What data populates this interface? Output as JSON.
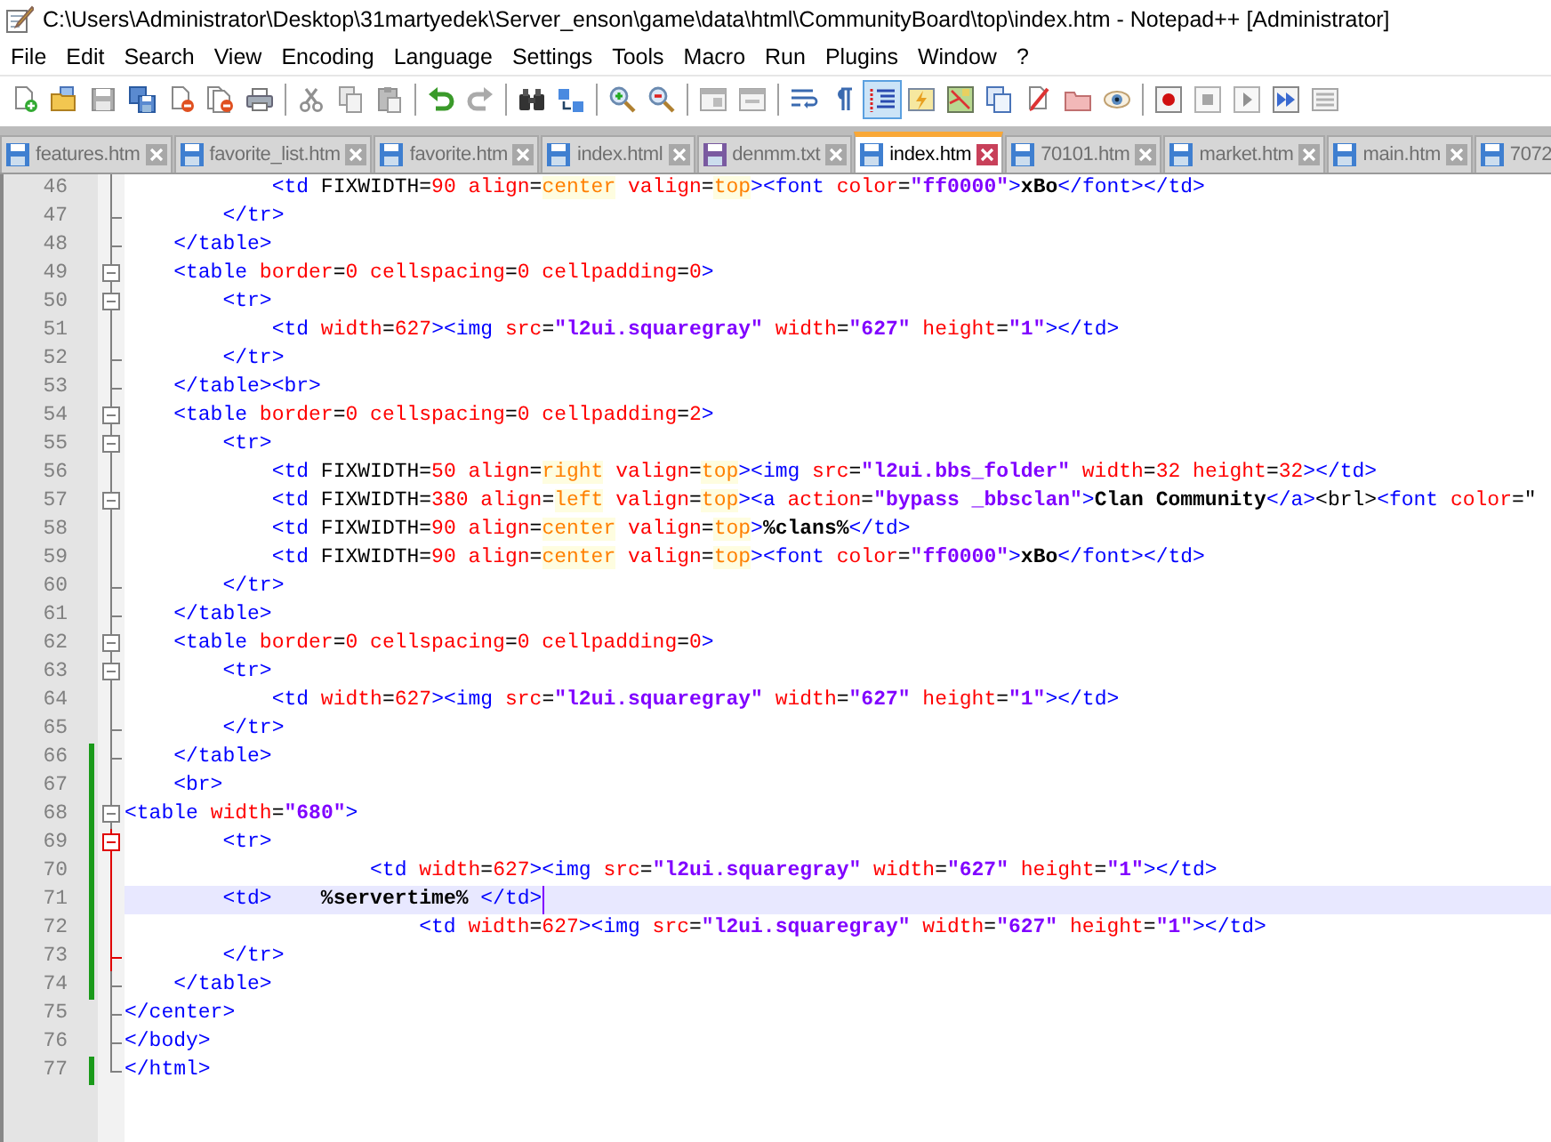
{
  "window": {
    "title": "C:\\Users\\Administrator\\Desktop\\31martyedek\\Server_enson\\game\\data\\html\\CommunityBoard\\top\\index.htm - Notepad++ [Administrator]"
  },
  "menu": [
    "File",
    "Edit",
    "Search",
    "View",
    "Encoding",
    "Language",
    "Settings",
    "Tools",
    "Macro",
    "Run",
    "Plugins",
    "Window",
    "?"
  ],
  "toolbar": {
    "groups": [
      {
        "buttons": [
          {
            "kind": "new",
            "disabled": false,
            "selected": false
          },
          {
            "kind": "open",
            "disabled": false,
            "selected": false
          },
          {
            "kind": "save",
            "disabled": true,
            "selected": false
          },
          {
            "kind": "save_all",
            "disabled": false,
            "selected": false
          },
          {
            "kind": "close",
            "disabled": false,
            "selected": false
          },
          {
            "kind": "close_all",
            "disabled": false,
            "selected": false
          },
          {
            "kind": "print",
            "disabled": false,
            "selected": false
          }
        ]
      },
      {
        "buttons": [
          {
            "kind": "cut",
            "disabled": true,
            "selected": false
          },
          {
            "kind": "copy",
            "disabled": true,
            "selected": false
          },
          {
            "kind": "paste",
            "disabled": true,
            "selected": false
          }
        ]
      },
      {
        "buttons": [
          {
            "kind": "undo",
            "disabled": false,
            "selected": false
          },
          {
            "kind": "redo",
            "disabled": true,
            "selected": false
          }
        ]
      },
      {
        "buttons": [
          {
            "kind": "find",
            "disabled": false,
            "selected": false
          },
          {
            "kind": "replace",
            "disabled": false,
            "selected": false
          }
        ]
      },
      {
        "buttons": [
          {
            "kind": "zoom_in",
            "disabled": false,
            "selected": false
          },
          {
            "kind": "zoom_out",
            "disabled": false,
            "selected": false
          }
        ]
      },
      {
        "buttons": [
          {
            "kind": "sync_v",
            "disabled": true,
            "selected": false
          },
          {
            "kind": "sync_h",
            "disabled": true,
            "selected": false
          }
        ]
      },
      {
        "buttons": [
          {
            "kind": "wrap",
            "disabled": false,
            "selected": false
          },
          {
            "kind": "all_chars",
            "disabled": false,
            "selected": false
          },
          {
            "kind": "indent_guide",
            "disabled": false,
            "selected": true
          },
          {
            "kind": "udl",
            "disabled": false,
            "selected": false
          },
          {
            "kind": "doc_map",
            "disabled": false,
            "selected": false
          },
          {
            "kind": "func_list",
            "disabled": false,
            "selected": false
          },
          {
            "kind": "pen_page",
            "disabled": false,
            "selected": false
          },
          {
            "kind": "folder",
            "disabled": false,
            "selected": false
          },
          {
            "kind": "monitor",
            "disabled": false,
            "selected": false
          }
        ]
      },
      {
        "buttons": [
          {
            "kind": "record",
            "disabled": false,
            "selected": false
          },
          {
            "kind": "stop",
            "disabled": true,
            "selected": false
          },
          {
            "kind": "play",
            "disabled": true,
            "selected": false
          },
          {
            "kind": "play_multi",
            "disabled": false,
            "selected": false
          },
          {
            "kind": "save_macro",
            "disabled": true,
            "selected": false
          }
        ]
      }
    ]
  },
  "tabs": [
    {
      "label": "features.htm",
      "selected": false,
      "color": "#3f7fd0"
    },
    {
      "label": "favorite_list.htm",
      "selected": false,
      "color": "#3f7fd0"
    },
    {
      "label": "favorite.htm",
      "selected": false,
      "color": "#3f7fd0"
    },
    {
      "label": "index.html",
      "selected": false,
      "color": "#3f7fd0"
    },
    {
      "label": "denmm.txt",
      "selected": false,
      "color": "#7a5aa0"
    },
    {
      "label": "index.htm",
      "selected": true,
      "color": "#3f7fd0"
    },
    {
      "label": "70101.htm",
      "selected": false,
      "color": "#3f7fd0"
    },
    {
      "label": "market.htm",
      "selected": false,
      "color": "#3f7fd0"
    },
    {
      "label": "main.htm",
      "selected": false,
      "color": "#3f7fd0"
    },
    {
      "label": "7072",
      "selected": false,
      "color": "#3f7fd0"
    }
  ],
  "editor": {
    "lines": [
      {
        "number": "46",
        "kind": "fold_body",
        "highlighted": false,
        "changed": false,
        "selected": false,
        "tokens": [
          {
            "kind": "tag",
            "text": "            <td"
          },
          {
            "kind": "plain",
            "text": " FIXWIDTH="
          },
          {
            "kind": "attr",
            "text": "90"
          },
          {
            "kind": "attr",
            "text": " align"
          },
          {
            "kind": "plain",
            "text": "="
          },
          {
            "kind": "word",
            "text": "center"
          },
          {
            "kind": "attr",
            "text": " valign"
          },
          {
            "kind": "plain",
            "text": "="
          },
          {
            "kind": "word",
            "text": "top"
          },
          {
            "kind": "tag",
            "text": "><font"
          },
          {
            "kind": "attr",
            "text": " color"
          },
          {
            "kind": "plain",
            "text": "="
          },
          {
            "kind": "str",
            "text": "\"ff0000\""
          },
          {
            "kind": "tag",
            "text": ">"
          },
          {
            "kind": "text",
            "text": "xBo"
          },
          {
            "kind": "tag",
            "text": "</font></td>"
          }
        ]
      },
      {
        "number": "47",
        "kind": "fold_end",
        "highlighted": false,
        "changed": false,
        "selected": false,
        "tokens": [
          {
            "kind": "tag",
            "text": "        </tr>"
          }
        ]
      },
      {
        "number": "48",
        "kind": "fold_end",
        "highlighted": false,
        "changed": false,
        "selected": false,
        "tokens": [
          {
            "kind": "tag",
            "text": "    </table>"
          }
        ]
      },
      {
        "number": "49",
        "kind": "fold_start",
        "highlighted": false,
        "changed": false,
        "selected": false,
        "tokens": [
          {
            "kind": "tag",
            "text": "    <table"
          },
          {
            "kind": "attr",
            "text": " border"
          },
          {
            "kind": "plain",
            "text": "="
          },
          {
            "kind": "attr",
            "text": "0"
          },
          {
            "kind": "attr",
            "text": " cellspacing"
          },
          {
            "kind": "plain",
            "text": "="
          },
          {
            "kind": "attr",
            "text": "0"
          },
          {
            "kind": "attr",
            "text": " cellpadding"
          },
          {
            "kind": "plain",
            "text": "="
          },
          {
            "kind": "attr",
            "text": "0"
          },
          {
            "kind": "tag",
            "text": ">"
          }
        ]
      },
      {
        "number": "50",
        "kind": "fold_start",
        "highlighted": false,
        "changed": false,
        "selected": false,
        "tokens": [
          {
            "kind": "tag",
            "text": "        <tr>"
          }
        ]
      },
      {
        "number": "51",
        "kind": "fold_body",
        "highlighted": false,
        "changed": false,
        "selected": false,
        "tokens": [
          {
            "kind": "tag",
            "text": "            <td"
          },
          {
            "kind": "attr",
            "text": " width"
          },
          {
            "kind": "plain",
            "text": "="
          },
          {
            "kind": "attr",
            "text": "627"
          },
          {
            "kind": "tag",
            "text": "><img"
          },
          {
            "kind": "attr",
            "text": " src"
          },
          {
            "kind": "plain",
            "text": "="
          },
          {
            "kind": "str",
            "text": "\"l2ui.squaregray\""
          },
          {
            "kind": "attr",
            "text": " width"
          },
          {
            "kind": "plain",
            "text": "="
          },
          {
            "kind": "str",
            "text": "\"627\""
          },
          {
            "kind": "attr",
            "text": " height"
          },
          {
            "kind": "plain",
            "text": "="
          },
          {
            "kind": "str",
            "text": "\"1\""
          },
          {
            "kind": "tag",
            "text": "></td>"
          }
        ]
      },
      {
        "number": "52",
        "kind": "fold_end",
        "highlighted": false,
        "changed": false,
        "selected": false,
        "tokens": [
          {
            "kind": "tag",
            "text": "        </tr>"
          }
        ]
      },
      {
        "number": "53",
        "kind": "fold_end",
        "highlighted": false,
        "changed": false,
        "selected": false,
        "tokens": [
          {
            "kind": "tag",
            "text": "    </table><br>"
          }
        ]
      },
      {
        "number": "54",
        "kind": "fold_start",
        "highlighted": false,
        "changed": false,
        "selected": false,
        "tokens": [
          {
            "kind": "tag",
            "text": "    <table"
          },
          {
            "kind": "attr",
            "text": " border"
          },
          {
            "kind": "plain",
            "text": "="
          },
          {
            "kind": "attr",
            "text": "0"
          },
          {
            "kind": "attr",
            "text": " cellspacing"
          },
          {
            "kind": "plain",
            "text": "="
          },
          {
            "kind": "attr",
            "text": "0"
          },
          {
            "kind": "attr",
            "text": " cellpadding"
          },
          {
            "kind": "plain",
            "text": "="
          },
          {
            "kind": "attr",
            "text": "2"
          },
          {
            "kind": "tag",
            "text": ">"
          }
        ]
      },
      {
        "number": "55",
        "kind": "fold_start",
        "highlighted": false,
        "changed": false,
        "selected": false,
        "tokens": [
          {
            "kind": "tag",
            "text": "        <tr>"
          }
        ]
      },
      {
        "number": "56",
        "kind": "fold_body",
        "highlighted": false,
        "changed": false,
        "selected": false,
        "tokens": [
          {
            "kind": "tag",
            "text": "            <td"
          },
          {
            "kind": "plain",
            "text": " FIXWIDTH="
          },
          {
            "kind": "attr",
            "text": "50"
          },
          {
            "kind": "attr",
            "text": " align"
          },
          {
            "kind": "plain",
            "text": "="
          },
          {
            "kind": "word",
            "text": "right"
          },
          {
            "kind": "attr",
            "text": " valign"
          },
          {
            "kind": "plain",
            "text": "="
          },
          {
            "kind": "word",
            "text": "top"
          },
          {
            "kind": "tag",
            "text": "><img"
          },
          {
            "kind": "attr",
            "text": " src"
          },
          {
            "kind": "plain",
            "text": "="
          },
          {
            "kind": "str",
            "text": "\"l2ui.bbs_folder\""
          },
          {
            "kind": "attr",
            "text": " width"
          },
          {
            "kind": "plain",
            "text": "="
          },
          {
            "kind": "attr",
            "text": "32"
          },
          {
            "kind": "attr",
            "text": " height"
          },
          {
            "kind": "plain",
            "text": "="
          },
          {
            "kind": "attr",
            "text": "32"
          },
          {
            "kind": "tag",
            "text": "></td>"
          }
        ]
      },
      {
        "number": "57",
        "kind": "fold_start",
        "highlighted": false,
        "changed": false,
        "selected": false,
        "tokens": [
          {
            "kind": "tag",
            "text": "            <td"
          },
          {
            "kind": "plain",
            "text": " FIXWIDTH="
          },
          {
            "kind": "attr",
            "text": "380"
          },
          {
            "kind": "attr",
            "text": " align"
          },
          {
            "kind": "plain",
            "text": "="
          },
          {
            "kind": "word",
            "text": "left"
          },
          {
            "kind": "attr",
            "text": " valign"
          },
          {
            "kind": "plain",
            "text": "="
          },
          {
            "kind": "word",
            "text": "top"
          },
          {
            "kind": "tag",
            "text": "><a"
          },
          {
            "kind": "attr",
            "text": " action"
          },
          {
            "kind": "plain",
            "text": "="
          },
          {
            "kind": "str",
            "text": "\"bypass _bbsclan\""
          },
          {
            "kind": "tag",
            "text": ">"
          },
          {
            "kind": "text",
            "text": "Clan Community"
          },
          {
            "kind": "tag",
            "text": "</a>"
          },
          {
            "kind": "plain",
            "text": "<brl>"
          },
          {
            "kind": "tag",
            "text": "<font"
          },
          {
            "kind": "attr",
            "text": " color"
          },
          {
            "kind": "plain",
            "text": "=\""
          }
        ]
      },
      {
        "number": "58",
        "kind": "fold_body",
        "highlighted": false,
        "changed": false,
        "selected": false,
        "tokens": [
          {
            "kind": "tag",
            "text": "            <td"
          },
          {
            "kind": "plain",
            "text": " FIXWIDTH="
          },
          {
            "kind": "attr",
            "text": "90"
          },
          {
            "kind": "attr",
            "text": " align"
          },
          {
            "kind": "plain",
            "text": "="
          },
          {
            "kind": "word",
            "text": "center"
          },
          {
            "kind": "attr",
            "text": " valign"
          },
          {
            "kind": "plain",
            "text": "="
          },
          {
            "kind": "word",
            "text": "top"
          },
          {
            "kind": "tag",
            "text": ">"
          },
          {
            "kind": "text",
            "text": "%clans%"
          },
          {
            "kind": "tag",
            "text": "</td>"
          }
        ]
      },
      {
        "number": "59",
        "kind": "fold_body",
        "highlighted": false,
        "changed": false,
        "selected": false,
        "tokens": [
          {
            "kind": "tag",
            "text": "            <td"
          },
          {
            "kind": "plain",
            "text": " FIXWIDTH="
          },
          {
            "kind": "attr",
            "text": "90"
          },
          {
            "kind": "attr",
            "text": " align"
          },
          {
            "kind": "plain",
            "text": "="
          },
          {
            "kind": "word",
            "text": "center"
          },
          {
            "kind": "attr",
            "text": " valign"
          },
          {
            "kind": "plain",
            "text": "="
          },
          {
            "kind": "word",
            "text": "top"
          },
          {
            "kind": "tag",
            "text": "><font"
          },
          {
            "kind": "attr",
            "text": " color"
          },
          {
            "kind": "plain",
            "text": "="
          },
          {
            "kind": "str",
            "text": "\"ff0000\""
          },
          {
            "kind": "tag",
            "text": ">"
          },
          {
            "kind": "text",
            "text": "xBo"
          },
          {
            "kind": "tag",
            "text": "</font></td>"
          }
        ]
      },
      {
        "number": "60",
        "kind": "fold_end",
        "highlighted": false,
        "changed": false,
        "selected": false,
        "tokens": [
          {
            "kind": "tag",
            "text": "        </tr>"
          }
        ]
      },
      {
        "number": "61",
        "kind": "fold_end",
        "highlighted": false,
        "changed": false,
        "selected": false,
        "tokens": [
          {
            "kind": "tag",
            "text": "    </table>"
          }
        ]
      },
      {
        "number": "62",
        "kind": "fold_start",
        "highlighted": false,
        "changed": false,
        "selected": false,
        "tokens": [
          {
            "kind": "tag",
            "text": "    <table"
          },
          {
            "kind": "attr",
            "text": " border"
          },
          {
            "kind": "plain",
            "text": "="
          },
          {
            "kind": "attr",
            "text": "0"
          },
          {
            "kind": "attr",
            "text": " cellspacing"
          },
          {
            "kind": "plain",
            "text": "="
          },
          {
            "kind": "attr",
            "text": "0"
          },
          {
            "kind": "attr",
            "text": " cellpadding"
          },
          {
            "kind": "plain",
            "text": "="
          },
          {
            "kind": "attr",
            "text": "0"
          },
          {
            "kind": "tag",
            "text": ">"
          }
        ]
      },
      {
        "number": "63",
        "kind": "fold_start",
        "highlighted": false,
        "changed": false,
        "selected": false,
        "tokens": [
          {
            "kind": "tag",
            "text": "        <tr>"
          }
        ]
      },
      {
        "number": "64",
        "kind": "fold_body",
        "highlighted": false,
        "changed": false,
        "selected": false,
        "tokens": [
          {
            "kind": "tag",
            "text": "            <td"
          },
          {
            "kind": "attr",
            "text": " width"
          },
          {
            "kind": "plain",
            "text": "="
          },
          {
            "kind": "attr",
            "text": "627"
          },
          {
            "kind": "tag",
            "text": "><img"
          },
          {
            "kind": "attr",
            "text": " src"
          },
          {
            "kind": "plain",
            "text": "="
          },
          {
            "kind": "str",
            "text": "\"l2ui.squaregray\""
          },
          {
            "kind": "attr",
            "text": " width"
          },
          {
            "kind": "plain",
            "text": "="
          },
          {
            "kind": "str",
            "text": "\"627\""
          },
          {
            "kind": "attr",
            "text": " height"
          },
          {
            "kind": "plain",
            "text": "="
          },
          {
            "kind": "str",
            "text": "\"1\""
          },
          {
            "kind": "tag",
            "text": "></td>"
          }
        ]
      },
      {
        "number": "65",
        "kind": "fold_end",
        "highlighted": false,
        "changed": false,
        "selected": false,
        "tokens": [
          {
            "kind": "tag",
            "text": "        </tr>"
          }
        ]
      },
      {
        "number": "66",
        "kind": "fold_end",
        "highlighted": false,
        "changed": true,
        "selected": false,
        "tokens": [
          {
            "kind": "tag",
            "text": "    </table>"
          }
        ]
      },
      {
        "number": "67",
        "kind": "fold_body",
        "highlighted": false,
        "changed": true,
        "selected": false,
        "tokens": [
          {
            "kind": "tag",
            "text": "    <br>"
          }
        ]
      },
      {
        "number": "68",
        "kind": "fold_start",
        "highlighted": false,
        "changed": true,
        "selected": false,
        "tokens": [
          {
            "kind": "tag",
            "text": "<table"
          },
          {
            "kind": "attr",
            "text": " width"
          },
          {
            "kind": "plain",
            "text": "="
          },
          {
            "kind": "str",
            "text": "\"680\""
          },
          {
            "kind": "tag",
            "text": ">"
          }
        ]
      },
      {
        "number": "69",
        "kind": "fold_start",
        "highlighted": true,
        "changed": true,
        "selected": false,
        "tokens": [
          {
            "kind": "tag",
            "text": "        <tr>"
          }
        ]
      },
      {
        "number": "70",
        "kind": "fold_body",
        "highlighted": true,
        "changed": true,
        "selected": false,
        "tokens": [
          {
            "kind": "tag",
            "text": "                    <td"
          },
          {
            "kind": "attr",
            "text": " width"
          },
          {
            "kind": "plain",
            "text": "="
          },
          {
            "kind": "attr",
            "text": "627"
          },
          {
            "kind": "tag",
            "text": "><img"
          },
          {
            "kind": "attr",
            "text": " src"
          },
          {
            "kind": "plain",
            "text": "="
          },
          {
            "kind": "str",
            "text": "\"l2ui.squaregray\""
          },
          {
            "kind": "attr",
            "text": " width"
          },
          {
            "kind": "plain",
            "text": "="
          },
          {
            "kind": "str",
            "text": "\"627\""
          },
          {
            "kind": "attr",
            "text": " height"
          },
          {
            "kind": "plain",
            "text": "="
          },
          {
            "kind": "str",
            "text": "\"1\""
          },
          {
            "kind": "tag",
            "text": "></td>"
          }
        ]
      },
      {
        "number": "71",
        "kind": "fold_body",
        "highlighted": true,
        "changed": true,
        "selected": true,
        "tokens": [
          {
            "kind": "tag",
            "text": "        <td>"
          },
          {
            "kind": "text",
            "text": "    %servertime%"
          },
          {
            "kind": "tag",
            "text": " </td>"
          }
        ]
      },
      {
        "number": "72",
        "kind": "fold_body",
        "highlighted": true,
        "changed": true,
        "selected": false,
        "tokens": [
          {
            "kind": "tag",
            "text": "                        <td"
          },
          {
            "kind": "attr",
            "text": " width"
          },
          {
            "kind": "plain",
            "text": "="
          },
          {
            "kind": "attr",
            "text": "627"
          },
          {
            "kind": "tag",
            "text": "><img"
          },
          {
            "kind": "attr",
            "text": " src"
          },
          {
            "kind": "plain",
            "text": "="
          },
          {
            "kind": "str",
            "text": "\"l2ui.squaregray\""
          },
          {
            "kind": "attr",
            "text": " width"
          },
          {
            "kind": "plain",
            "text": "="
          },
          {
            "kind": "str",
            "text": "\"627\""
          },
          {
            "kind": "attr",
            "text": " height"
          },
          {
            "kind": "plain",
            "text": "="
          },
          {
            "kind": "str",
            "text": "\"1\""
          },
          {
            "kind": "tag",
            "text": "></td>"
          }
        ]
      },
      {
        "number": "73",
        "kind": "fold_end",
        "highlighted": true,
        "changed": true,
        "selected": false,
        "tokens": [
          {
            "kind": "tag",
            "text": "        </tr>"
          }
        ]
      },
      {
        "number": "74",
        "kind": "fold_end",
        "highlighted": false,
        "changed": true,
        "selected": false,
        "tokens": [
          {
            "kind": "tag",
            "text": "    </table>"
          }
        ]
      },
      {
        "number": "75",
        "kind": "fold_end",
        "highlighted": false,
        "changed": false,
        "selected": false,
        "tokens": [
          {
            "kind": "tag",
            "text": "</center>"
          }
        ]
      },
      {
        "number": "76",
        "kind": "fold_end",
        "highlighted": false,
        "changed": false,
        "selected": false,
        "tokens": [
          {
            "kind": "tag",
            "text": "</body>"
          }
        ]
      },
      {
        "number": "77",
        "kind": "fold_last",
        "highlighted": false,
        "changed": true,
        "selected": false,
        "tokens": [
          {
            "kind": "tag",
            "text": "</html>"
          }
        ]
      }
    ]
  }
}
